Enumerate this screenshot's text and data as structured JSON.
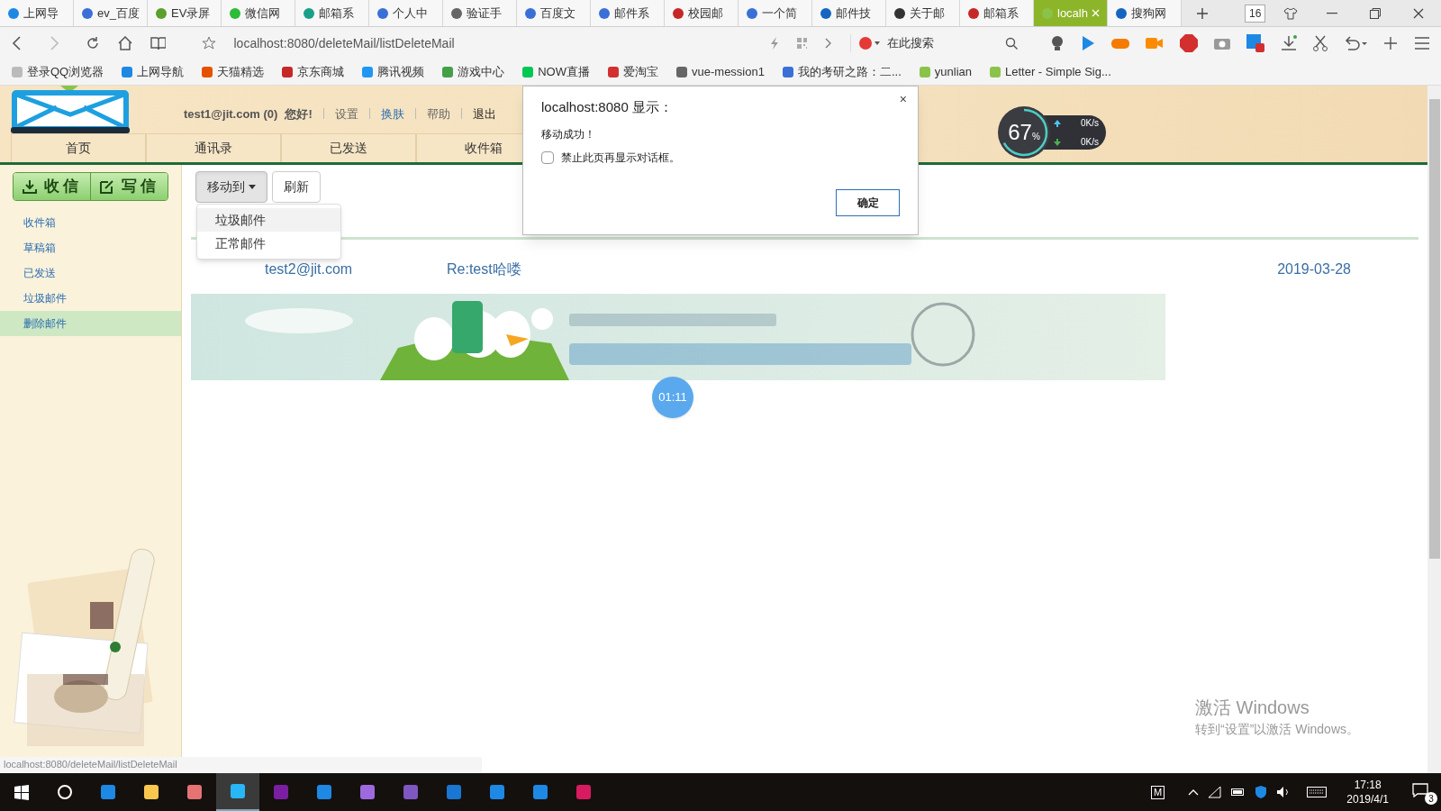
{
  "browser": {
    "tabs": [
      {
        "label": "上网导",
        "color": "#1e88e5",
        "selected": false
      },
      {
        "label": "ev_百度",
        "color": "#3b6fd8",
        "selected": false
      },
      {
        "label": "EV录屏",
        "color": "#5aa02c",
        "selected": false
      },
      {
        "label": "微信网",
        "color": "#2dbb3a",
        "selected": false
      },
      {
        "label": "邮箱系",
        "color": "#1a9f8a",
        "selected": false
      },
      {
        "label": "个人中",
        "color": "#3b6fd8",
        "selected": false
      },
      {
        "label": "验证手",
        "color": "#666666",
        "selected": false
      },
      {
        "label": "百度文",
        "color": "#3b6fd8",
        "selected": false
      },
      {
        "label": "邮件系",
        "color": "#3b6fd8",
        "selected": false
      },
      {
        "label": "校园邮",
        "color": "#c62828",
        "selected": false
      },
      {
        "label": "一个简",
        "color": "#3b6fd8",
        "selected": false
      },
      {
        "label": "邮件技",
        "color": "#1565c0",
        "selected": false
      },
      {
        "label": "关于邮",
        "color": "#333333",
        "selected": false
      },
      {
        "label": "邮箱系",
        "color": "#c62828",
        "selected": false
      },
      {
        "label": "localh",
        "color": "#8bc34a",
        "selected": true
      },
      {
        "label": "搜狗网",
        "color": "#1565c0",
        "selected": false
      }
    ],
    "tab_count": "16",
    "address": "localhost:8080/deleteMail/listDeleteMail",
    "search_placeholder": "在此搜索",
    "bookmarks": [
      {
        "label": "登录QQ浏览器",
        "color": "#bbbbbb"
      },
      {
        "label": "上网导航",
        "color": "#1e88e5"
      },
      {
        "label": "天猫精选",
        "color": "#e65100"
      },
      {
        "label": "京东商城",
        "color": "#c62828"
      },
      {
        "label": "腾讯视频",
        "color": "#2196f3"
      },
      {
        "label": "游戏中心",
        "color": "#43a047"
      },
      {
        "label": "NOW直播",
        "color": "#00c853"
      },
      {
        "label": "爱淘宝",
        "color": "#d32f2f"
      },
      {
        "label": "vue-mession1",
        "color": "#666666"
      },
      {
        "label": "我的考研之路：二...",
        "color": "#3b6fd8"
      },
      {
        "label": "yunlian",
        "color": "#8bc34a"
      },
      {
        "label": "Letter - Simple Sig...",
        "color": "#8bc34a"
      }
    ]
  },
  "page": {
    "user": {
      "email": "test1@jit.com (0)",
      "greeting": "您好!",
      "links": [
        "设置",
        "换肤",
        "帮助",
        "退出"
      ]
    },
    "nav": [
      {
        "label": "首页"
      },
      {
        "label": "通讯录"
      },
      {
        "label": "已发送"
      },
      {
        "label": "收件箱"
      }
    ],
    "action_buttons": [
      "收信",
      "写信"
    ],
    "folders": [
      {
        "label": "收件箱",
        "selected": false
      },
      {
        "label": "草稿箱",
        "selected": false
      },
      {
        "label": "已发送",
        "selected": false
      },
      {
        "label": "垃圾邮件",
        "selected": false
      },
      {
        "label": "删除邮件",
        "selected": true
      }
    ],
    "move_button": "移动到",
    "refresh_button": "刷新",
    "move_menu": [
      {
        "label": "垃圾邮件",
        "highlighted": true
      },
      {
        "label": "正常邮件",
        "highlighted": false
      }
    ],
    "mails": [
      {
        "from": "test2@jit.com",
        "subject": "Re:test哈喽",
        "date": "2019-03-28"
      }
    ]
  },
  "dialog": {
    "title": "localhost:8080 显示：",
    "message": "移动成功！",
    "checkbox_label": "禁止此页再显示对话框。",
    "checked": false,
    "ok": "确定",
    "close": "×"
  },
  "net_widget": {
    "percent": "67",
    "unit": "%",
    "up": "0K/s",
    "down": "0K/s"
  },
  "timer": "01:11",
  "status_url": "localhost:8080/deleteMail/listDeleteMail",
  "watermark": {
    "title": "激活 Windows",
    "subtitle": "转到“设置”以激活 Windows。"
  },
  "taskbar": {
    "ime": "M",
    "time": "17:18",
    "date": "2019/4/1",
    "notifications": "3"
  }
}
